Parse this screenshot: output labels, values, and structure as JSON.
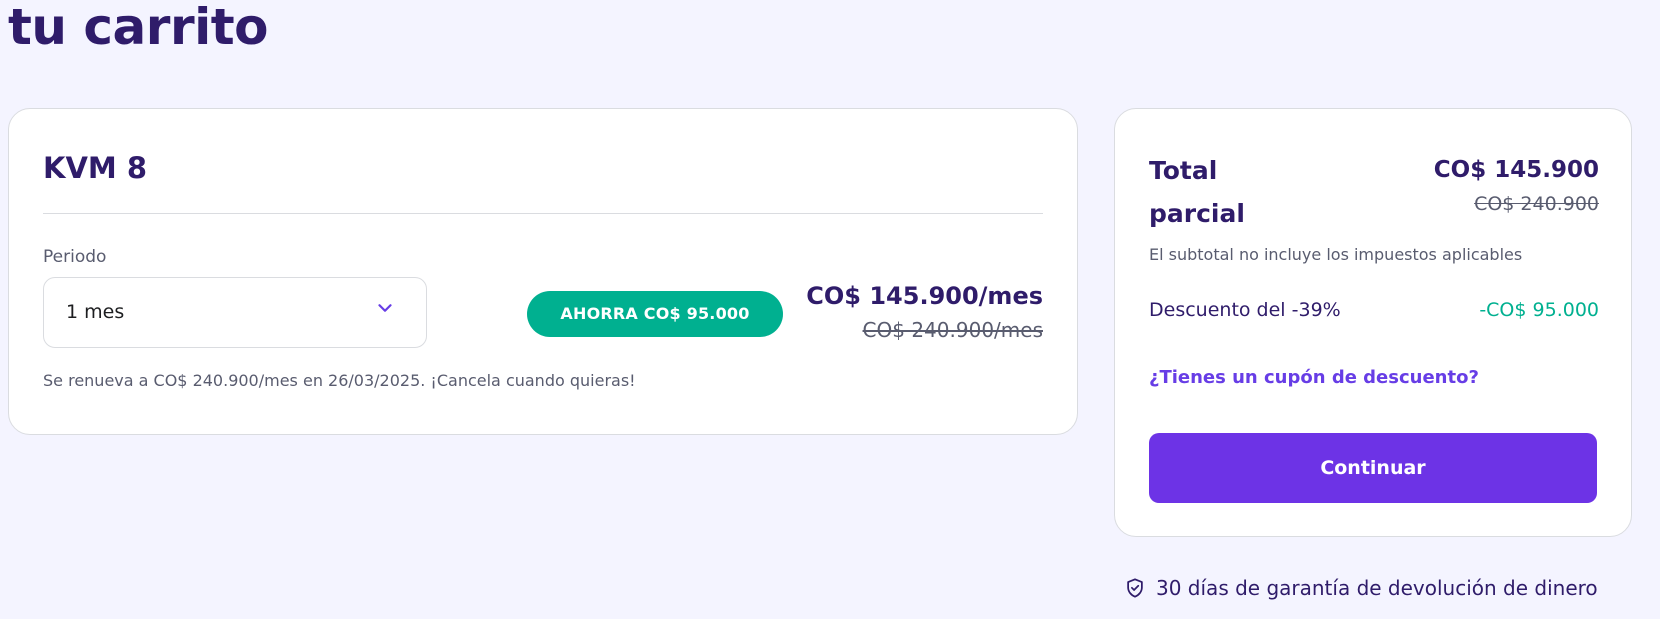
{
  "page": {
    "title": "tu carrito"
  },
  "product": {
    "name": "KVM 8",
    "period_label": "Periodo",
    "period_value": "1 mes",
    "savings_badge": "AHORRA CO$ 95.000",
    "price_current": "CO$ 145.900/mes",
    "price_old": "CO$ 240.900/mes",
    "renewal_note": "Se renueva a CO$ 240.900/mes en 26/03/2025. ¡Cancela cuando quieras!"
  },
  "summary": {
    "total_label": "Total parcial",
    "total_current": "CO$ 145.900",
    "total_old": "CO$ 240.900",
    "tax_note": "El subtotal no incluye los impuestos aplicables",
    "discount_label": "Descuento del -39%",
    "discount_value": "-CO$ 95.000",
    "coupon_link": "¿Tienes un cupón de descuento?",
    "continue_button": "Continuar"
  },
  "guarantee": {
    "text": "30 días de garantía de devolución de dinero",
    "icon": "shield-check-icon"
  },
  "colors": {
    "background": "#f4f4ff",
    "primary_text": "#2f1c6a",
    "accent_purple": "#673de6",
    "button_purple": "#6d33e6",
    "success_green": "#00b090",
    "muted_text": "#595c6f",
    "border": "#dadce0"
  }
}
